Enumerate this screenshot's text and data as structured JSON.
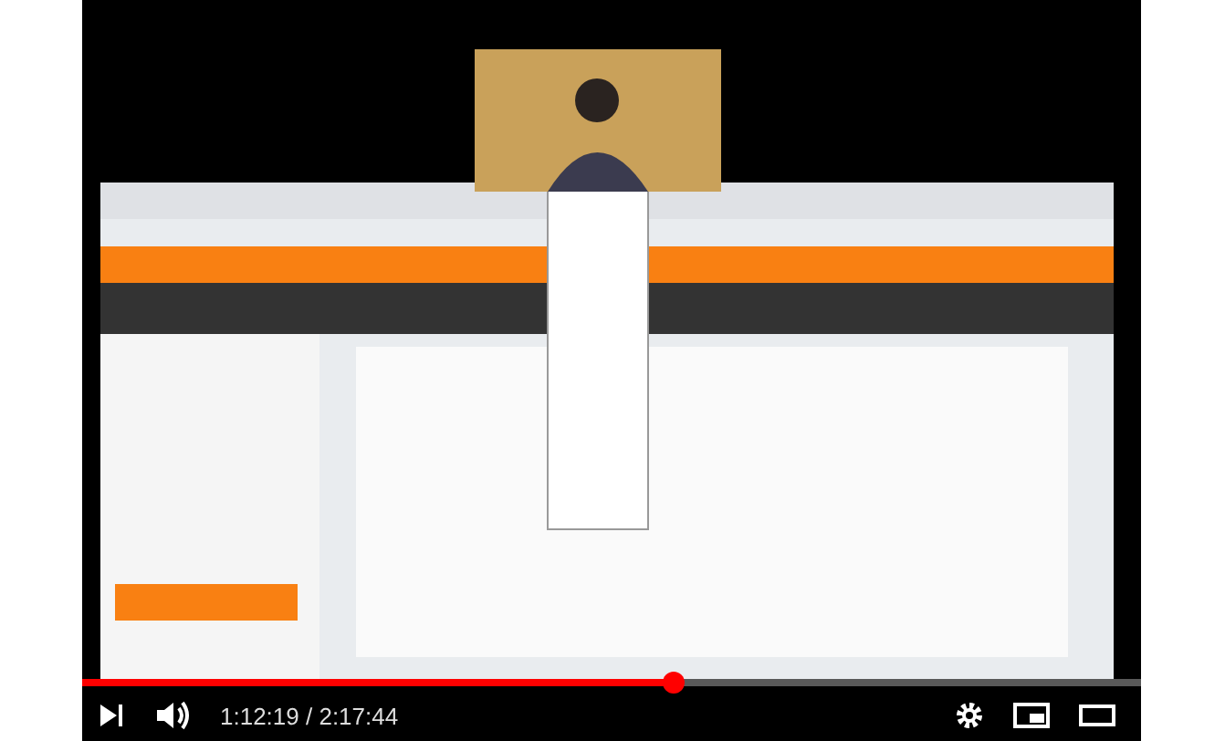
{
  "player": {
    "progress": {
      "level": 0.56
    },
    "time": "1:12:19 / 2:17:44"
  }
}
